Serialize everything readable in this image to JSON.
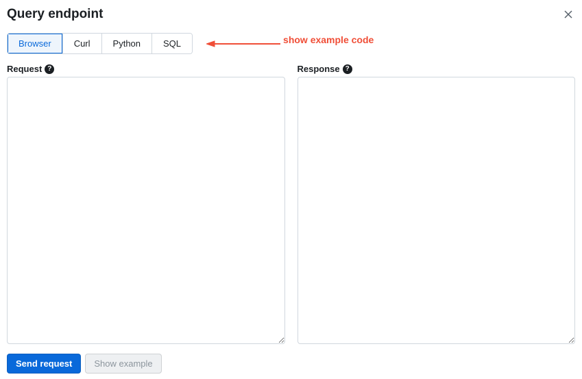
{
  "header": {
    "title": "Query endpoint"
  },
  "tabs": {
    "items": [
      {
        "label": "Browser",
        "name": "tab-browser",
        "active": true
      },
      {
        "label": "Curl",
        "name": "tab-curl",
        "active": false
      },
      {
        "label": "Python",
        "name": "tab-python",
        "active": false
      },
      {
        "label": "SQL",
        "name": "tab-sql",
        "active": false
      }
    ]
  },
  "annotation": {
    "text": "show example code"
  },
  "request": {
    "label": "Request",
    "help": "?",
    "value": ""
  },
  "response": {
    "label": "Response",
    "help": "?",
    "value": ""
  },
  "buttons": {
    "send": "Send request",
    "show_example": "Show example"
  }
}
